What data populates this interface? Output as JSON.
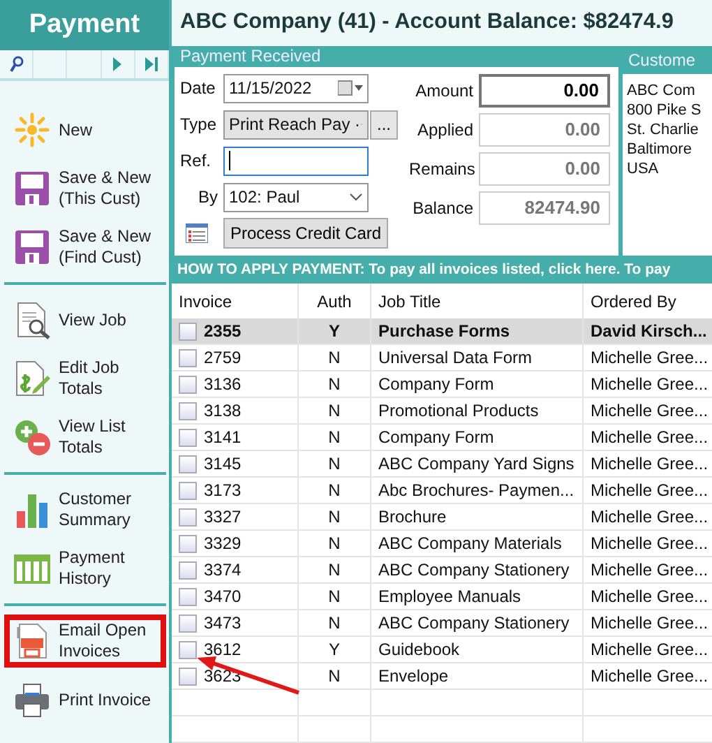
{
  "sidebar": {
    "title": "Payment",
    "nav_buttons": [
      {
        "kind": "search"
      },
      {
        "kind": "blank"
      },
      {
        "kind": "blank"
      },
      {
        "kind": "next"
      },
      {
        "kind": "last"
      }
    ],
    "groups": [
      {
        "items": [
          {
            "kind": "new",
            "label": "New",
            "highlighted": false
          },
          {
            "kind": "save",
            "label": "Save & New\n(This Cust)",
            "highlighted": false
          },
          {
            "kind": "save",
            "label": "Save & New\n(Find Cust)",
            "highlighted": false
          }
        ]
      },
      {
        "items": [
          {
            "kind": "view",
            "label": "View Job",
            "highlighted": false
          },
          {
            "kind": "edit",
            "label": "Edit Job\nTotals",
            "highlighted": false
          },
          {
            "kind": "totals",
            "label": "View List\nTotals",
            "highlighted": false
          }
        ]
      },
      {
        "items": [
          {
            "kind": "chart",
            "label": "Customer\nSummary",
            "highlighted": false
          },
          {
            "kind": "history",
            "label": "Payment\nHistory",
            "highlighted": false
          }
        ]
      },
      {
        "items": [
          {
            "kind": "pdf",
            "label": "Email Open\nInvoices",
            "highlighted": true
          },
          {
            "kind": "print",
            "label": "Print Invoice",
            "highlighted": false
          }
        ]
      }
    ]
  },
  "title": "ABC Company (41) - Account Balance: $82474.9",
  "payment": {
    "header": "Payment Received",
    "date": {
      "label": "Date",
      "value": "11/15/2022"
    },
    "type": {
      "label": "Type",
      "value": "Print Reach Pay ·",
      "more": "..."
    },
    "ref": {
      "label": "Ref."
    },
    "by": {
      "label": "By",
      "value": "102: Paul"
    },
    "process_button": "Process Credit Card",
    "amounts": [
      {
        "label": "Amount",
        "value": "0.00",
        "editable": true
      },
      {
        "label": "Applied",
        "value": "0.00",
        "editable": false
      },
      {
        "label": "Remains",
        "value": "0.00",
        "editable": false
      },
      {
        "label": "Balance",
        "value": "82474.90",
        "editable": false
      }
    ]
  },
  "customer": {
    "header": "Custome",
    "lines": [
      "ABC Com",
      "800 Pike S",
      "St. Charlie",
      "Baltimore",
      "USA"
    ]
  },
  "instructions": "HOW TO APPLY PAYMENT: To pay all invoices listed, click here. To pay",
  "table": {
    "columns": [
      "Invoice",
      "Auth",
      "Job Title",
      "Ordered By"
    ],
    "rows": [
      {
        "invoice": "2355",
        "auth": "Y",
        "job": "Purchase Forms",
        "ordered_by": "David Kirsch...",
        "checked": false,
        "selected": true
      },
      {
        "invoice": "2759",
        "auth": "N",
        "job": "Universal Data Form",
        "ordered_by": "Michelle Gree...",
        "checked": false,
        "selected": false
      },
      {
        "invoice": "3136",
        "auth": "N",
        "job": "Company Form",
        "ordered_by": "Michelle Gree...",
        "checked": false,
        "selected": false
      },
      {
        "invoice": "3138",
        "auth": "N",
        "job": "Promotional Products",
        "ordered_by": "Michelle Gree...",
        "checked": false,
        "selected": false
      },
      {
        "invoice": "3141",
        "auth": "N",
        "job": "Company Form",
        "ordered_by": "Michelle Gree...",
        "checked": false,
        "selected": false
      },
      {
        "invoice": "3145",
        "auth": "N",
        "job": "ABC Company Yard Signs",
        "ordered_by": "Michelle Gree...",
        "checked": false,
        "selected": false
      },
      {
        "invoice": "3173",
        "auth": "N",
        "job": "Abc Brochures- Paymen...",
        "ordered_by": "Michelle Gree...",
        "checked": false,
        "selected": false
      },
      {
        "invoice": "3327",
        "auth": "N",
        "job": "Brochure",
        "ordered_by": "Michelle Gree...",
        "checked": false,
        "selected": false
      },
      {
        "invoice": "3329",
        "auth": "N",
        "job": "ABC Company Materials",
        "ordered_by": "Michelle Gree...",
        "checked": false,
        "selected": false
      },
      {
        "invoice": "3374",
        "auth": "N",
        "job": "ABC Company Stationery",
        "ordered_by": "Michelle Gree...",
        "checked": false,
        "selected": false
      },
      {
        "invoice": "3470",
        "auth": "N",
        "job": "Employee Manuals",
        "ordered_by": "Michelle Gree...",
        "checked": false,
        "selected": false
      },
      {
        "invoice": "3473",
        "auth": "N",
        "job": "ABC Company Stationery",
        "ordered_by": "Michelle Gree...",
        "checked": false,
        "selected": false
      },
      {
        "invoice": "3612",
        "auth": "Y",
        "job": "Guidebook",
        "ordered_by": "Michelle Gree...",
        "checked": false,
        "selected": false
      },
      {
        "invoice": "3623",
        "auth": "N",
        "job": "Envelope",
        "ordered_by": "Michelle Gree...",
        "checked": false,
        "selected": false
      }
    ]
  }
}
